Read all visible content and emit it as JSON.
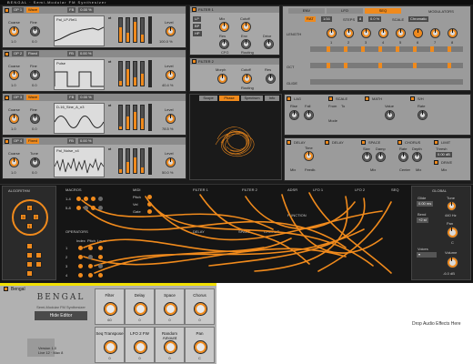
{
  "plugin": {
    "title": "BENGAL",
    "subtitle": "Semi-Modular FM Synthesizer"
  },
  "oscillators": [
    {
      "id": "op1",
      "name": "OP 1",
      "mode": "Wave",
      "fb": "FB",
      "fb_value": "0.00 %",
      "wave": "Pal_LP-Rel1",
      "coarse_label": "Coarse",
      "coarse_value": "1.0",
      "fine_label": "Fine",
      "fine_value": "0.0",
      "level_label": "Level",
      "level_value": "100.0 %"
    },
    {
      "id": "op2",
      "name": "OP 2",
      "mode": "Fixed",
      "fb": "FB",
      "fb_value": "0.00 %",
      "wave": "Pulse",
      "coarse_label": "Coarse",
      "coarse_value": "1.0",
      "fine_label": "Fine",
      "fine_value": "0.0",
      "level_label": "Level",
      "level_value": "40.4 %"
    },
    {
      "id": "op3",
      "name": "OP 3",
      "mode": "Wave",
      "fb": "FB",
      "fb_value": "0.00 %",
      "wave": "D-16_Sine_A_n3",
      "coarse_label": "Coarse",
      "coarse_value": "1.0",
      "fine_label": "Fine",
      "fine_value": "0.0",
      "level_label": "Level",
      "level_value": "78.5 %"
    },
    {
      "id": "op4",
      "name": "OP 4",
      "mode": "Fixed",
      "fb": "FB",
      "fb_value": "0.00 %",
      "wave": "Pal_Noise_x4",
      "coarse_label": "Coarse",
      "coarse_value": "1.0",
      "fine_label": "Tune",
      "fine_value": "0.0",
      "level_label": "Level",
      "level_value": "50.0 %"
    }
  ],
  "filter1": {
    "title": "FILTER 1",
    "mix": "Mix",
    "mix_value": "100 %",
    "cutoff": "Cutoff",
    "cutoff_value": "2.31 kHz",
    "res": "Res",
    "res_value": "0.0 %",
    "env": "Env",
    "drive": "Drive",
    "cfg": "CFG",
    "routing": "Routing"
  },
  "filter2": {
    "title": "FILTER 2",
    "morph": "Morph",
    "cutoff": "Cutoff",
    "res": "Res",
    "routing": "Routing"
  },
  "sequencer": {
    "tabs": [
      "ENV",
      "LFO",
      "SEQ"
    ],
    "selected_tab": "SEQ",
    "modulators_label": "MODULATORS",
    "rate_mode": "RAT",
    "time": "1/16",
    "steps_label": "STEPS",
    "steps_value": "8",
    "swing": "0.0 %",
    "scale_label": "SCALE",
    "scale_value": "Chromatic",
    "length_label": "LENGTH",
    "row_labels": [
      "OCT",
      "GLIDE"
    ],
    "steps": [
      "1",
      "2",
      "3",
      "4",
      "5",
      "6",
      "7",
      "8"
    ]
  },
  "scope": {
    "tabs": [
      "Scope",
      "Phase",
      "Spectrum",
      "Info"
    ],
    "selected": "Phase"
  },
  "lag": {
    "title": "LAG",
    "rise": "Rise",
    "fall": "Fall"
  },
  "scale": {
    "title": "SCALE",
    "from": "From",
    "to": "To",
    "mode": "Mode"
  },
  "math": {
    "title": "MATH",
    "value": "Value"
  },
  "sh": {
    "title": "S/H",
    "rate": "Rate"
  },
  "delay": {
    "title": "DELAY",
    "time": "Time",
    "mix": "Mix",
    "feedback": "Feedb."
  },
  "delay_fx": {
    "title": "DELAY"
  },
  "space": {
    "title": "SPACE",
    "size": "Size",
    "damp": "Damp",
    "mix": "Mix"
  },
  "chorus": {
    "title": "CHORUS",
    "rate": "Rate",
    "depth": "Depth",
    "mix": "Mix",
    "center": "Center"
  },
  "limit": {
    "title": "LIMIT",
    "thresh": "Thresh",
    "thresh_value": "0.00 dB"
  },
  "drive": {
    "title": "DRIVE",
    "mix": "Mix"
  },
  "seqfx": {
    "title": "SEQ"
  },
  "matrix": {
    "algorithm_label": "ALGORITHM",
    "macros_label": "MACROS",
    "macro_rows": [
      "1-4",
      "5-8"
    ],
    "midi_label": "MIDI",
    "midi_rows": [
      "Pitch",
      "Vel",
      "Gate"
    ],
    "filter1_label": "FILTER 1",
    "filter2_label": "FILTER 2",
    "adsr_label": "ADSR",
    "lfo1_label": "LFO 1",
    "lfo2_label": "LFO 2",
    "seq_label": "SEQ",
    "function_label": "FUNCTION",
    "operators_label": "OPERATORS",
    "operator_cols": [
      "Index",
      "Pitch",
      "Level"
    ],
    "operator_rows": [
      "1",
      "2",
      "3",
      "4"
    ],
    "delay_label": "DELAY",
    "space_label": "SPACE",
    "chorus_label": "CHORUS",
    "global_label": "GLOBAL",
    "glide_label": "Glide",
    "glide_value": "0.00 ms",
    "tune_label": "Tune",
    "tune_value": "440 Hz",
    "bend_label": "Bend",
    "bend_value": "+2 st",
    "pan_label": "Pan",
    "pan_value": "C",
    "voices_label": "Voices",
    "volume_label": "Volume",
    "volume_value": "-6.0 dB"
  },
  "device": {
    "name": "Bengal",
    "logo": "BENGAL",
    "subtitle": "Semi-Modular FM Synthesizer",
    "hide_editor": "Hide Editor",
    "version": "Version 1.0",
    "credits": "Live 12 · Max 8",
    "macros": [
      {
        "label": "Filter",
        "value": "60"
      },
      {
        "label": "Delay",
        "value": "0"
      },
      {
        "label": "Space",
        "value": "0"
      },
      {
        "label": "Chorus",
        "value": "0"
      },
      {
        "label": "Seq Transpose",
        "value": "0"
      },
      {
        "label": "LFO 2 FW",
        "value": "0"
      },
      {
        "label": "Random Amount",
        "value": "0"
      },
      {
        "label": "Pan",
        "value": "C"
      }
    ]
  },
  "drop_zone": {
    "text": "Drop Audio Effects Here"
  },
  "colors": {
    "accent": "#f08a1c",
    "panel": "#a7a7a7",
    "dark": "#1b1b1b",
    "device_bar": "#f2e000"
  }
}
